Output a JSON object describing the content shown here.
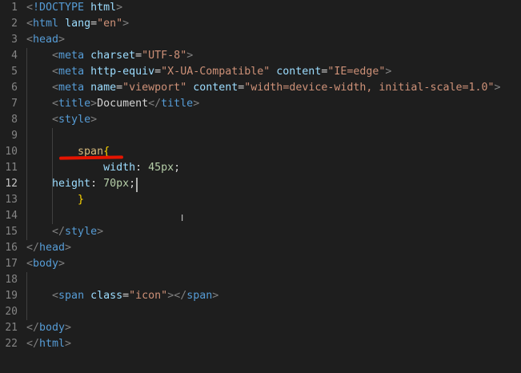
{
  "editor": {
    "lines": [
      {
        "n": "1",
        "segs": [
          [
            "punct",
            "<"
          ],
          [
            "tag",
            "!DOCTYPE"
          ],
          [
            "plain",
            " "
          ],
          [
            "attr",
            "html"
          ],
          [
            "punct",
            ">"
          ]
        ]
      },
      {
        "n": "2",
        "segs": [
          [
            "punct",
            "<"
          ],
          [
            "tag",
            "html"
          ],
          [
            "plain",
            " "
          ],
          [
            "attr",
            "lang"
          ],
          [
            "plain",
            "="
          ],
          [
            "str",
            "\"en\""
          ],
          [
            "punct",
            ">"
          ]
        ]
      },
      {
        "n": "3",
        "segs": [
          [
            "punct",
            "<"
          ],
          [
            "tag",
            "head"
          ],
          [
            "punct",
            ">"
          ]
        ]
      },
      {
        "n": "4",
        "segs": [
          [
            "plain",
            "    "
          ],
          [
            "punct",
            "<"
          ],
          [
            "tag",
            "meta"
          ],
          [
            "plain",
            " "
          ],
          [
            "attr",
            "charset"
          ],
          [
            "plain",
            "="
          ],
          [
            "str",
            "\"UTF-8\""
          ],
          [
            "punct",
            ">"
          ]
        ]
      },
      {
        "n": "5",
        "segs": [
          [
            "plain",
            "    "
          ],
          [
            "punct",
            "<"
          ],
          [
            "tag",
            "meta"
          ],
          [
            "plain",
            " "
          ],
          [
            "attr",
            "http-equiv"
          ],
          [
            "plain",
            "="
          ],
          [
            "str",
            "\"X-UA-Compatible\""
          ],
          [
            "plain",
            " "
          ],
          [
            "attr",
            "content"
          ],
          [
            "plain",
            "="
          ],
          [
            "str",
            "\"IE=edge\""
          ],
          [
            "punct",
            ">"
          ]
        ]
      },
      {
        "n": "6",
        "segs": [
          [
            "plain",
            "    "
          ],
          [
            "punct",
            "<"
          ],
          [
            "tag",
            "meta"
          ],
          [
            "plain",
            " "
          ],
          [
            "attr",
            "name"
          ],
          [
            "plain",
            "="
          ],
          [
            "str",
            "\"viewport\""
          ],
          [
            "plain",
            " "
          ],
          [
            "attr",
            "content"
          ],
          [
            "plain",
            "="
          ],
          [
            "str",
            "\"width=device-width, initial-scale=1.0\""
          ],
          [
            "punct",
            ">"
          ]
        ]
      },
      {
        "n": "7",
        "segs": [
          [
            "plain",
            "    "
          ],
          [
            "punct",
            "<"
          ],
          [
            "tag",
            "title"
          ],
          [
            "punct",
            ">"
          ],
          [
            "plain",
            "Document"
          ],
          [
            "punct",
            "</"
          ],
          [
            "tag",
            "title"
          ],
          [
            "punct",
            ">"
          ]
        ]
      },
      {
        "n": "8",
        "segs": [
          [
            "plain",
            "    "
          ],
          [
            "punct",
            "<"
          ],
          [
            "tag",
            "style"
          ],
          [
            "punct",
            ">"
          ]
        ]
      },
      {
        "n": "9",
        "segs": []
      },
      {
        "n": "10",
        "segs": [
          [
            "plain",
            "        "
          ],
          [
            "sel",
            "span"
          ],
          [
            "brace",
            "{"
          ]
        ]
      },
      {
        "n": "11",
        "segs": [
          [
            "plain",
            "            "
          ],
          [
            "attr",
            "width"
          ],
          [
            "plain",
            ": "
          ],
          [
            "num",
            "45px"
          ],
          [
            "plain",
            ";"
          ]
        ]
      },
      {
        "n": "12",
        "active": true,
        "segs": [
          [
            "plain",
            "    "
          ],
          [
            "attr",
            "height"
          ],
          [
            "plain",
            ": "
          ],
          [
            "num",
            "70px"
          ],
          [
            "plain",
            ";"
          ]
        ]
      },
      {
        "n": "13",
        "segs": [
          [
            "plain",
            "        "
          ],
          [
            "brace",
            "}"
          ]
        ]
      },
      {
        "n": "14",
        "segs": []
      },
      {
        "n": "15",
        "segs": [
          [
            "plain",
            "    "
          ],
          [
            "punct",
            "</"
          ],
          [
            "tag",
            "style"
          ],
          [
            "punct",
            ">"
          ]
        ]
      },
      {
        "n": "16",
        "segs": [
          [
            "punct",
            "</"
          ],
          [
            "tag",
            "head"
          ],
          [
            "punct",
            ">"
          ]
        ]
      },
      {
        "n": "17",
        "segs": [
          [
            "punct",
            "<"
          ],
          [
            "tag",
            "body"
          ],
          [
            "punct",
            ">"
          ]
        ]
      },
      {
        "n": "18",
        "segs": []
      },
      {
        "n": "19",
        "segs": [
          [
            "plain",
            "    "
          ],
          [
            "punct",
            "<"
          ],
          [
            "tag",
            "span"
          ],
          [
            "plain",
            " "
          ],
          [
            "attr",
            "class"
          ],
          [
            "plain",
            "="
          ],
          [
            "str",
            "\"icon\""
          ],
          [
            "punct",
            "></"
          ],
          [
            "tag",
            "span"
          ],
          [
            "punct",
            ">"
          ]
        ]
      },
      {
        "n": "20",
        "segs": []
      },
      {
        "n": "21",
        "segs": [
          [
            "punct",
            "</"
          ],
          [
            "tag",
            "body"
          ],
          [
            "punct",
            ">"
          ]
        ]
      },
      {
        "n": "22",
        "segs": [
          [
            "punct",
            "</"
          ],
          [
            "tag",
            "html"
          ],
          [
            "punct",
            ">"
          ]
        ]
      }
    ]
  },
  "annotation": {
    "underline_color": "#e51400"
  }
}
